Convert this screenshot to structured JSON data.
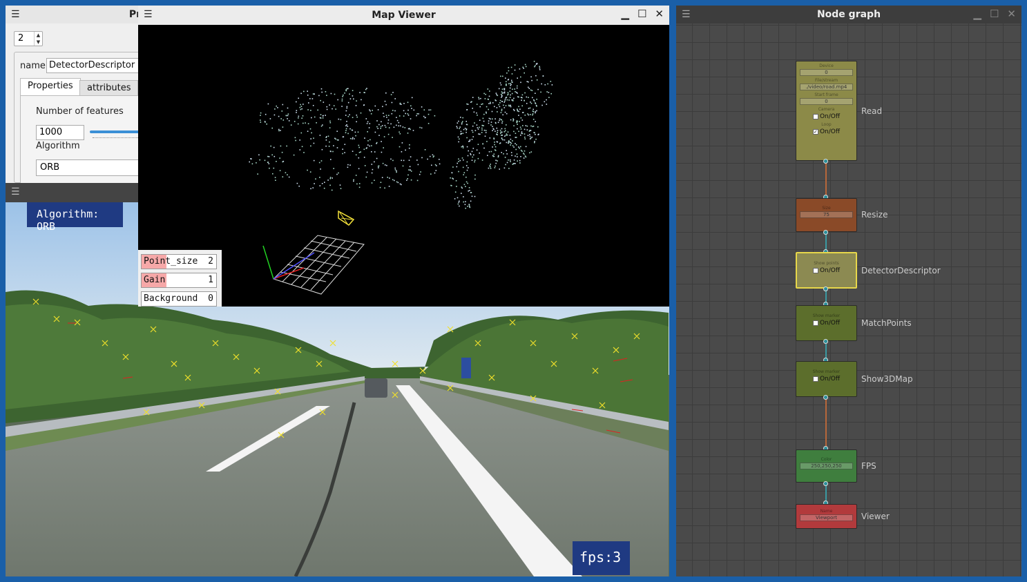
{
  "properties_window": {
    "title_fragment": "Pr",
    "spin_value": "2",
    "name_label": "name",
    "name_value": "DetectorDescriptor",
    "tabs": [
      "Properties",
      "attributes"
    ],
    "num_features_label": "Number of features",
    "num_features_value": "1000",
    "algorithm_label": "Algorithm",
    "algorithm_value": "ORB"
  },
  "camera_view": {
    "algorithm_overlay": "Algorithm: ORB",
    "fps_overlay": "fps:3"
  },
  "map_viewer": {
    "title": "Map Viewer",
    "params": [
      {
        "label": "Point_size",
        "value": "2",
        "fill_fraction": 0.33
      },
      {
        "label": "Gain",
        "value": "1",
        "fill_fraction": 0.33
      },
      {
        "label": "Background",
        "value": "0",
        "fill_fraction": 0.0
      }
    ]
  },
  "node_graph": {
    "title": "Node graph",
    "nodes": [
      {
        "name": "Read",
        "color": "#8c8a48",
        "fields": [
          {
            "label": "Device",
            "value": "0"
          },
          {
            "label": "File/stream",
            "value": "./video/road.mp4"
          },
          {
            "label": "Start frame",
            "value": "0"
          }
        ],
        "checks": [
          {
            "label": "Camera",
            "text": "On/Off",
            "checked": false
          },
          {
            "label": "Loop",
            "text": "On/Off",
            "checked": true
          }
        ]
      },
      {
        "name": "Resize",
        "color": "#8a4a28",
        "fields": [
          {
            "label": "Size",
            "value": "75"
          }
        ],
        "checks": []
      },
      {
        "name": "DetectorDescriptor",
        "color": "#8c8a52",
        "fields": [],
        "checks": [
          {
            "label": "Show points",
            "text": "On/Off",
            "checked": false
          }
        ]
      },
      {
        "name": "MatchPoints",
        "color": "#5c6e2c",
        "fields": [],
        "checks": [
          {
            "label": "Show marker",
            "text": "On/Off",
            "checked": false
          }
        ]
      },
      {
        "name": "Show3DMap",
        "color": "#5c6e2c",
        "fields": [],
        "checks": [
          {
            "label": "Show marker",
            "text": "On/Off",
            "checked": false
          }
        ]
      },
      {
        "name": "FPS",
        "color": "#3f7e3e",
        "fields": [
          {
            "label": "Color",
            "value": "250,250,250"
          }
        ],
        "checks": []
      },
      {
        "name": "Viewer",
        "color": "#b23a3c",
        "fields": [
          {
            "label": "Name",
            "value": "Viewport"
          }
        ],
        "checks": []
      }
    ]
  },
  "colors": {
    "desktop": "#1a5fa8",
    "overlay_bg": "#1f3a82",
    "param_fill": "#f6a8a8",
    "link": "#b8673a",
    "port": "#2a8f9a"
  }
}
